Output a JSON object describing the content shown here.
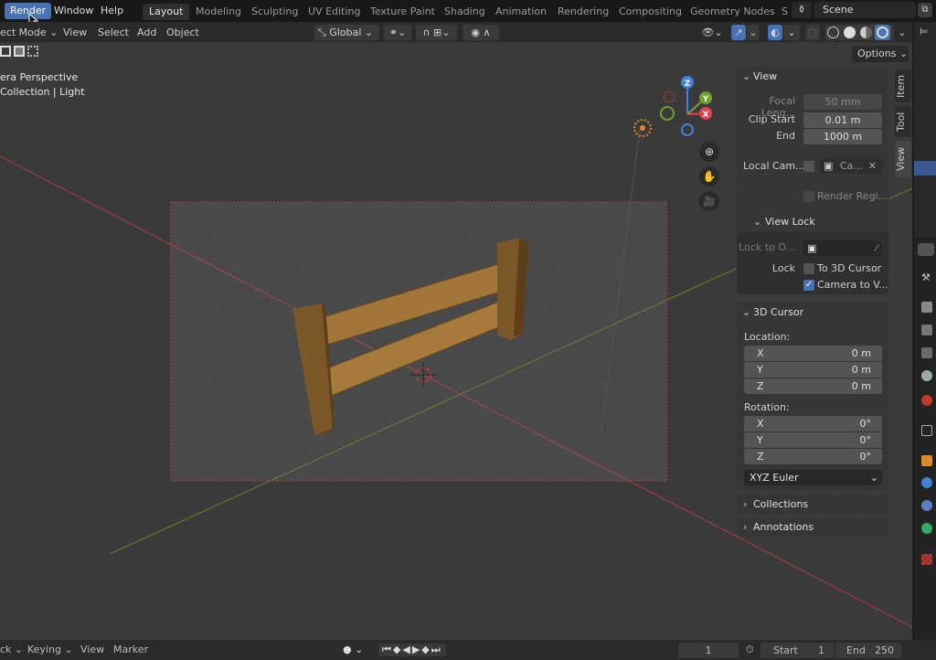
{
  "topbar": {
    "menus": [
      "Render",
      "Window",
      "Help"
    ],
    "active_menu": "Render",
    "workspaces": [
      "Layout",
      "Modeling",
      "Sculpting",
      "UV Editing",
      "Texture Paint",
      "Shading",
      "Animation",
      "Rendering",
      "Compositing",
      "Geometry Nodes",
      "S"
    ],
    "active_workspace": "Layout",
    "scene": "Scene"
  },
  "header": {
    "mode": "ect Mode",
    "menus": [
      "View",
      "Select",
      "Add",
      "Object"
    ],
    "orientation": "Global",
    "options": "Options"
  },
  "viewport": {
    "info_line1": "era Perspective",
    "info_line2": "Collection | Light",
    "gizmo": {
      "z": "Z",
      "y": "Y",
      "x": "X"
    },
    "accent_x": "#e0434e",
    "accent_y": "#6fa22b",
    "accent_z": "#3f83d8"
  },
  "sidebar": {
    "tabs": [
      "Item",
      "Tool",
      "View"
    ],
    "active_tab": "View",
    "view": {
      "title": "View",
      "focal_label": "Focal Leng...",
      "focal_value": "50 mm",
      "clip_start_label": "Clip Start",
      "clip_start": "0.01 m",
      "end_label": "End",
      "clip_end": "1000 m",
      "local_cam_label": "Local Cam...",
      "local_cam_value": "Ca...",
      "render_region": "Render Regi...",
      "view_lock_title": "View Lock",
      "lock_to_label": "Lock to O...",
      "lock_label": "Lock",
      "to_3d_cursor": "To 3D Cursor",
      "to_3d_cursor_checked": false,
      "camera_to_view": "Camera to V...",
      "camera_to_view_checked": true
    },
    "cursor": {
      "title": "3D Cursor",
      "location_label": "Location:",
      "location": [
        {
          "axis": "X",
          "value": "0 m"
        },
        {
          "axis": "Y",
          "value": "0 m"
        },
        {
          "axis": "Z",
          "value": "0 m"
        }
      ],
      "rotation_label": "Rotation:",
      "rotation": [
        {
          "axis": "X",
          "value": "0°"
        },
        {
          "axis": "Y",
          "value": "0°"
        },
        {
          "axis": "Z",
          "value": "0°"
        }
      ],
      "mode": "XYZ Euler"
    },
    "collections": "Collections",
    "annotations": "Annotations"
  },
  "timeline": {
    "menus": [
      "ck",
      "Keying",
      "View",
      "Marker"
    ],
    "current_frame": "1",
    "start_label": "Start",
    "start": "1",
    "end_label": "End",
    "end": "250"
  }
}
